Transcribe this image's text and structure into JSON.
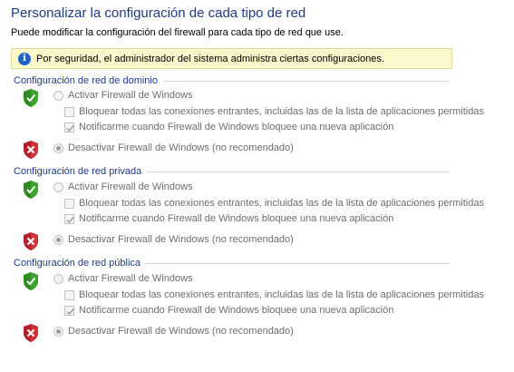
{
  "page": {
    "title": "Personalizar la configuración de cada tipo de red",
    "description": "Puede modificar la configuración del firewall para cada tipo de red que use."
  },
  "info_bar": {
    "icon": "info-icon",
    "text": "Por seguridad, el administrador del sistema administra ciertas configuraciones."
  },
  "colors": {
    "title": "#1e3a8a",
    "info_background": "#fbf8cc",
    "shield_on": "#2e8b1f",
    "shield_off": "#c1272d"
  },
  "sections": [
    {
      "title": "Configuración de red de dominio",
      "enable_label": "Activar Firewall de Windows",
      "enable_selected": false,
      "block_label": "Bloquear todas las conexiones entrantes, incluidas las de la lista de aplicaciones permitidas",
      "block_checked": false,
      "notify_label": "Notificarme cuando Firewall de Windows bloquee una nueva aplicación",
      "notify_checked": true,
      "disable_label": "Desactivar Firewall de Windows (no recomendado)",
      "disable_selected": true
    },
    {
      "title": "Configuración de red privada",
      "enable_label": "Activar Firewall de Windows",
      "enable_selected": false,
      "block_label": "Bloquear todas las conexiones entrantes, incluidas las de la lista de aplicaciones permitidas",
      "block_checked": false,
      "notify_label": "Notificarme cuando Firewall de Windows bloquee una nueva aplicación",
      "notify_checked": true,
      "disable_label": "Desactivar Firewall de Windows (no recomendado)",
      "disable_selected": true
    },
    {
      "title": "Configuración de red pública",
      "enable_label": "Activar Firewall de Windows",
      "enable_selected": false,
      "block_label": "Bloquear todas las conexiones entrantes, incluidas las de la lista de aplicaciones permitidas",
      "block_checked": false,
      "notify_label": "Notificarme cuando Firewall de Windows bloquee una nueva aplicación",
      "notify_checked": true,
      "disable_label": "Desactivar Firewall de Windows (no recomendado)",
      "disable_selected": true
    }
  ]
}
